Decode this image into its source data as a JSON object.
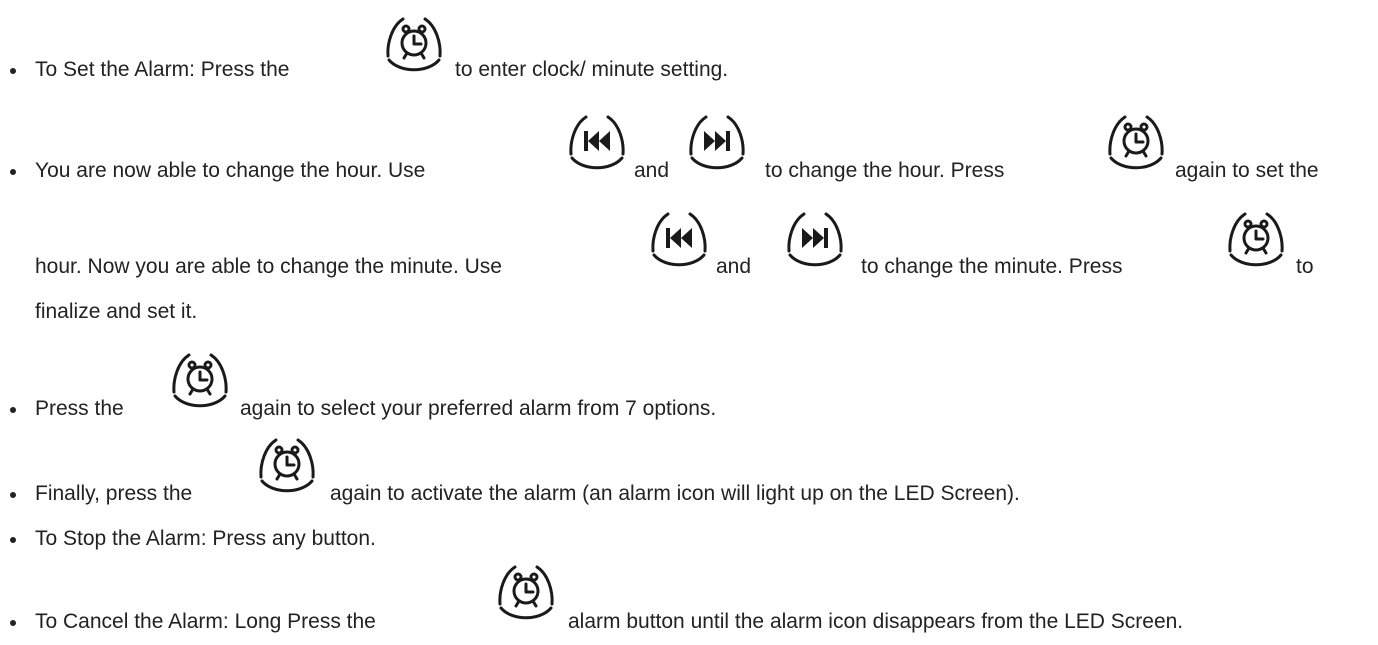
{
  "instructions": {
    "l1": {
      "a": "To Set the Alarm: Press the",
      "b": "to enter clock/ minute setting."
    },
    "l2": {
      "a": "You are now able to change the hour. Use",
      "b": "and",
      "c": "to change the hour. Press",
      "d": "again to set the"
    },
    "l3": {
      "a": "hour. Now you are able to change the minute. Use",
      "b": "and",
      "c": "to change the minute. Press",
      "d": "to"
    },
    "l4": {
      "a": "finalize and set it."
    },
    "l5": {
      "a": "Press the",
      "b": "again to select your preferred alarm from 7 options."
    },
    "l6": {
      "a": "Finally, press the",
      "b": "again to activate the alarm (an alarm icon will light up on the LED Screen)."
    },
    "l7": {
      "a": "To Stop the Alarm: Press any button."
    },
    "l8": {
      "a": "To Cancel the Alarm: Long Press the",
      "b": "alarm button until the alarm icon disappears from the LED Screen."
    }
  },
  "icons": {
    "alarm": "alarm-clock-icon",
    "previous": "skip-previous-icon",
    "next": "skip-next-icon"
  },
  "colors": {
    "text": "#222222",
    "icon": "#1a1a1a"
  }
}
